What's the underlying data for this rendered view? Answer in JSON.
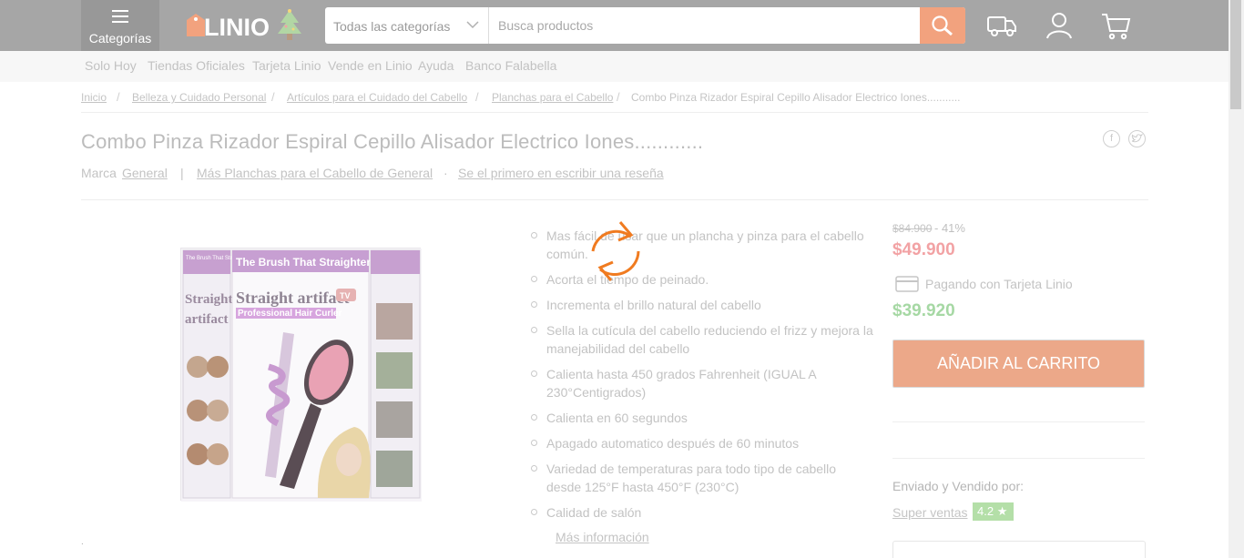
{
  "header": {
    "categories_label": "Categorías",
    "logo_text": "LINIO",
    "search": {
      "category_value": "Todas las categorías",
      "placeholder": "Busca productos"
    }
  },
  "subnav": [
    "Solo Hoy",
    "Tiendas Oficiales",
    "Tarjeta Linio",
    "Vende en Linio",
    "Ayuda",
    "Banco Falabella"
  ],
  "breadcrumb": [
    "Inicio",
    "Belleza y Cuidado Personal",
    "Artículos para el Cuidado del Cabello",
    "Planchas para el Cabello",
    "Combo Pinza Rizador Espiral Cepillo Alisador Electrico Iones..........."
  ],
  "breadcrumb_separator": "/",
  "product": {
    "title": "Combo Pinza Rizador Espiral Cepillo Alisador Electrico Iones............",
    "brand_prefix": "Marca",
    "brand": "General",
    "divider": "|",
    "more_brand": "Más Planchas para el Cabello de General",
    "dot": "·",
    "review_link": "Se el primero en escribir una reseña",
    "features": [
      "Mas fácil de usar que un plancha y pinza para el cabello común.",
      "Acorta el tiempo de peinado.",
      "Incrementa el brillo natural del cabello",
      "Sella la cutícula del cabello reduciendo el frizz y mejora la manejabilidad del cabello",
      "Calienta hasta 450 grados Fahrenheit (IGUAL A 230°Centigrados)",
      "Calienta en 60 segundos",
      "Apagado automatico después de 60 minutos",
      "Variedad de temperaturas para todo tipo de cabello desde 125°F hasta 450°F (230°C)",
      "Calidad de salón"
    ],
    "more_info": "Más información",
    "image_texts": {
      "banner": "The Brush That Straightens Hair!",
      "brand_a": "Straight artifact",
      "brand_b": "Straight artifact",
      "subtitle": "Professional Hair Curler",
      "tag_small": "The Brush That Straightens Hair!",
      "tv": "TV"
    }
  },
  "pricing": {
    "old_price": "$84.900",
    "discount": "- 41%",
    "price": "$49.900",
    "card_label": "Pagando con Tarjeta Linio",
    "card_price": "$39.920",
    "add_to_cart": "AÑADIR AL CARRITO",
    "sold_by_label": "Enviado y Vendido por:",
    "seller": "Super ventas",
    "seller_rating": "4.2"
  },
  "colors": {
    "accent": "#f2a27e",
    "price": "#f2a2a4",
    "card_price": "#a6d8a4",
    "spinner": "#f07b20"
  }
}
